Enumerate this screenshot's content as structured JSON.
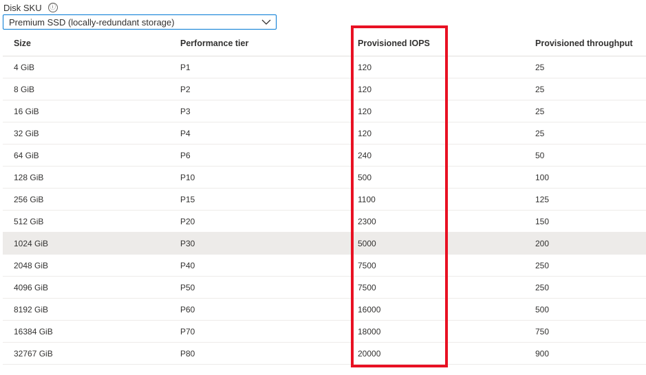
{
  "disk_sku": {
    "label": "Disk SKU",
    "info_icon": "ⓘ",
    "selected": "Premium SSD (locally-redundant storage)"
  },
  "table": {
    "headers": {
      "size": "Size",
      "tier": "Performance tier",
      "iops": "Provisioned IOPS",
      "throughput": "Provisioned throughput"
    },
    "rows": [
      {
        "size": "4 GiB",
        "tier": "P1",
        "iops": "120",
        "throughput": "25"
      },
      {
        "size": "8 GiB",
        "tier": "P2",
        "iops": "120",
        "throughput": "25"
      },
      {
        "size": "16 GiB",
        "tier": "P3",
        "iops": "120",
        "throughput": "25"
      },
      {
        "size": "32 GiB",
        "tier": "P4",
        "iops": "120",
        "throughput": "25"
      },
      {
        "size": "64 GiB",
        "tier": "P6",
        "iops": "240",
        "throughput": "50"
      },
      {
        "size": "128 GiB",
        "tier": "P10",
        "iops": "500",
        "throughput": "100"
      },
      {
        "size": "256 GiB",
        "tier": "P15",
        "iops": "1100",
        "throughput": "125"
      },
      {
        "size": "512 GiB",
        "tier": "P20",
        "iops": "2300",
        "throughput": "150"
      },
      {
        "size": "1024 GiB",
        "tier": "P30",
        "iops": "5000",
        "throughput": "200"
      },
      {
        "size": "2048 GiB",
        "tier": "P40",
        "iops": "7500",
        "throughput": "250"
      },
      {
        "size": "4096 GiB",
        "tier": "P50",
        "iops": "7500",
        "throughput": "250"
      },
      {
        "size": "8192 GiB",
        "tier": "P60",
        "iops": "16000",
        "throughput": "500"
      },
      {
        "size": "16384 GiB",
        "tier": "P70",
        "iops": "18000",
        "throughput": "750"
      },
      {
        "size": "32767 GiB",
        "tier": "P80",
        "iops": "20000",
        "throughput": "900"
      }
    ],
    "selected_row": 8
  },
  "colors": {
    "highlight": "#e81123",
    "select_border": "#0078d4",
    "selected_row_bg": "#edebe9"
  }
}
